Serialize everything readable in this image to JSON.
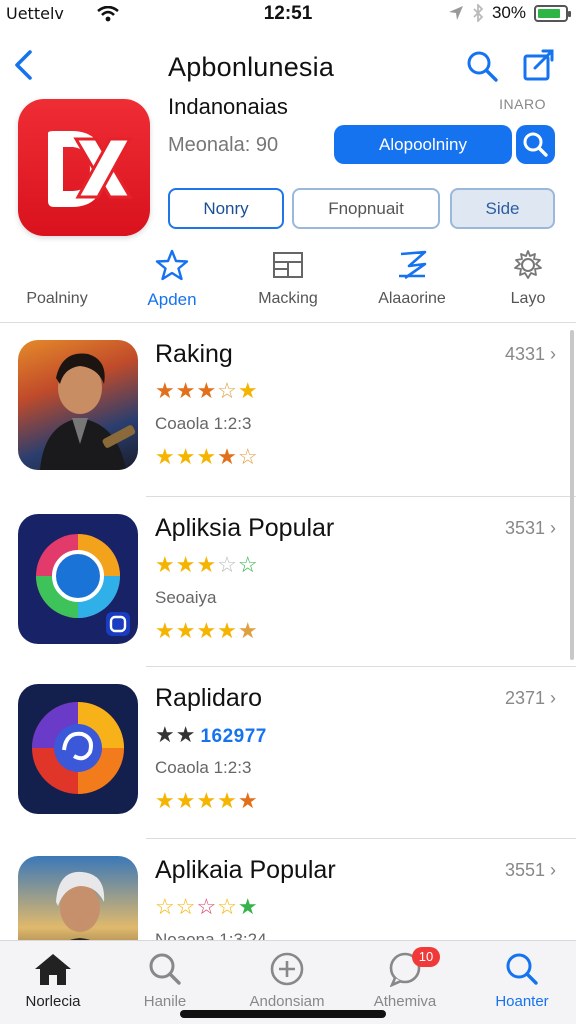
{
  "status_bar": {
    "carrier": "Uettelv",
    "time": "12:51",
    "battery": "30%",
    "battery_level": 0.85
  },
  "header": {
    "title": "Apbonlunesia",
    "back_icon": "chevron-left-icon",
    "search_icon": "search-icon",
    "share_icon": "share-edit-icon"
  },
  "app": {
    "icon": "dx-logo",
    "subtitle": "Indanonaias",
    "tag": "INARO",
    "meta": "Meonala: 90",
    "cta_label": "Alopoolniny",
    "segments": [
      "Nonry",
      "Fnopnuait",
      "Side"
    ]
  },
  "categories": [
    {
      "label": "Poalniny",
      "icon": "none"
    },
    {
      "label": "Apden",
      "icon": "star-icon"
    },
    {
      "label": "Macking",
      "icon": "layout-icon"
    },
    {
      "label": "Alaaorine",
      "icon": "flag-icon"
    },
    {
      "label": "Layo",
      "icon": "gear-icon"
    }
  ],
  "list": [
    {
      "name": "Raking",
      "count": "4331",
      "subtitle": "Coaola 1:2:3",
      "blue_text": ""
    },
    {
      "name": "Apliksia Popular",
      "count": "3531",
      "subtitle": "Seoaiya",
      "blue_text": ""
    },
    {
      "name": "Raplidaro",
      "count": "2371",
      "subtitle": "Coaola 1:2:3",
      "blue_text": "162977"
    },
    {
      "name": "Aplikaia Popular",
      "count": "3551",
      "subtitle": "Noaona 1:3:24",
      "blue_text": ""
    }
  ],
  "tabbar": [
    {
      "label": "Norlecia",
      "icon": "home-icon"
    },
    {
      "label": "Hanile",
      "icon": "search-icon"
    },
    {
      "label": "Andonsiam",
      "icon": "plus-circle-icon"
    },
    {
      "label": "Athemiva",
      "icon": "chat-icon",
      "badge": "10"
    },
    {
      "label": "Hoanter",
      "icon": "search-icon"
    }
  ],
  "colors": {
    "accent": "#1673f0",
    "brand_red": "#e52229",
    "star": "#f5b400",
    "badge": "#f03a3a"
  }
}
